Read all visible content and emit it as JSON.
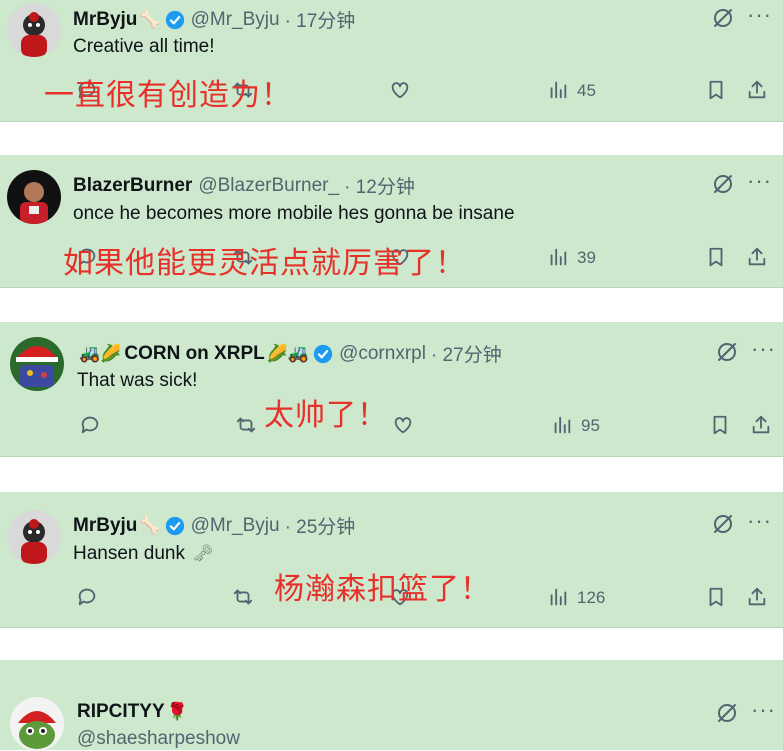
{
  "tweets": [
    {
      "name": "MrByju",
      "name_emoji": "🦴",
      "handle": "@Mr_Byju",
      "time": "· 17分钟",
      "text": "Creative all time!",
      "views": "45",
      "translation": "一直很有创造力！"
    },
    {
      "name": "BlazerBurner",
      "handle": "@BlazerBurner_",
      "time": "· 12分钟",
      "text": "once he becomes more mobile hes gonna be insane",
      "views": "39",
      "translation": "如果他能更灵活点就厉害了！"
    },
    {
      "name_prefix_emoji": "🚜🌽",
      "name": "CORN on XRPL",
      "name_emoji": "🌽🚜",
      "handle": "@cornxrpl",
      "time": "· 27分钟",
      "text": "That was sick!",
      "views": "95",
      "translation": "太帅了！"
    },
    {
      "name": "MrByju",
      "name_emoji": "🦴",
      "handle": "@Mr_Byju",
      "time": "· 25分钟",
      "text": "Hansen dunk",
      "text_emoji": "🗝",
      "views": "126",
      "translation": "杨瀚森扣篮了！"
    },
    {
      "name": "RIPCITYY",
      "name_emoji": "🌹",
      "handle": "@shaesharpeshow"
    }
  ],
  "colors": {
    "card_bg": "#cde8cd",
    "verified": "#1d9bf0",
    "translation": "#e8302a",
    "secondary_text": "#536471"
  }
}
